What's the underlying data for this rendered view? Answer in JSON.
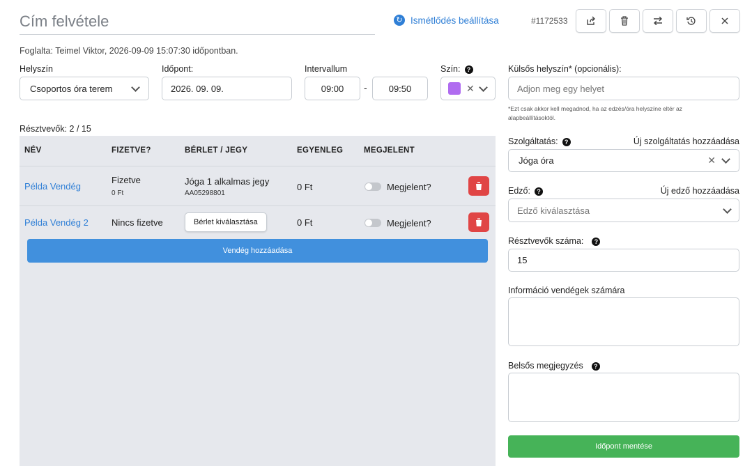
{
  "header": {
    "title_placeholder": "Cím felvétele",
    "repeat_label": "Ismétlődés beállítása",
    "event_id": "#1172533"
  },
  "booked_by": "Foglalta: Teimel Viktor, 2026-09-09 15:07:30 időpontban.",
  "form": {
    "location_label": "Helyszín",
    "location_value": "Csoportos óra terem",
    "time_label": "Időpont:",
    "time_value": "2026. 09. 09.",
    "interval_label": "Intervallum",
    "interval_start": "09:00",
    "interval_sep": "-",
    "interval_end": "09:50",
    "color_label": "Szín:",
    "color_value": "#b06cf0"
  },
  "participants_label": "Résztvevők: 2 / 15",
  "table": {
    "headers": [
      "NÉV",
      "FIZETVE?",
      "BÉRLET / JEGY",
      "EGYENLEG",
      "MEGJELENT"
    ],
    "rows": [
      {
        "name": "Példa Vendég",
        "paid": "Fizetve",
        "paid_amount": "0 Ft",
        "pass_name": "Jóga 1 alkalmas jegy",
        "pass_code": "AA05298801",
        "balance": "0 Ft",
        "attended_label": "Megjelent?"
      },
      {
        "name": "Példa Vendég 2",
        "paid": "Nincs fizetve",
        "pass_button": "Bérlet kiválasztása",
        "balance": "0 Ft",
        "attended_label": "Megjelent?"
      }
    ],
    "add_guest": "Vendég hozzáadása"
  },
  "right": {
    "external_label": "Külsős helyszín* (opcionális):",
    "external_placeholder": "Adjon meg egy helyet",
    "external_hint": "*Ezt csak akkor kell megadnod, ha az edzés/óra helyszíne eltér az alapbeállításoktól.",
    "service_label": "Szolgáltatás:",
    "service_add": "Új szolgáltatás hozzáadása",
    "service_value": "Jóga óra",
    "trainer_label": "Edző:",
    "trainer_add": "Új edző hozzáadása",
    "trainer_placeholder": "Edző kiválasztása",
    "count_label": "Résztvevők száma:",
    "count_value": "15",
    "info_label": "Információ vendégek számára",
    "note_label": "Belsős megjegyzés",
    "save": "Időpont mentése"
  }
}
